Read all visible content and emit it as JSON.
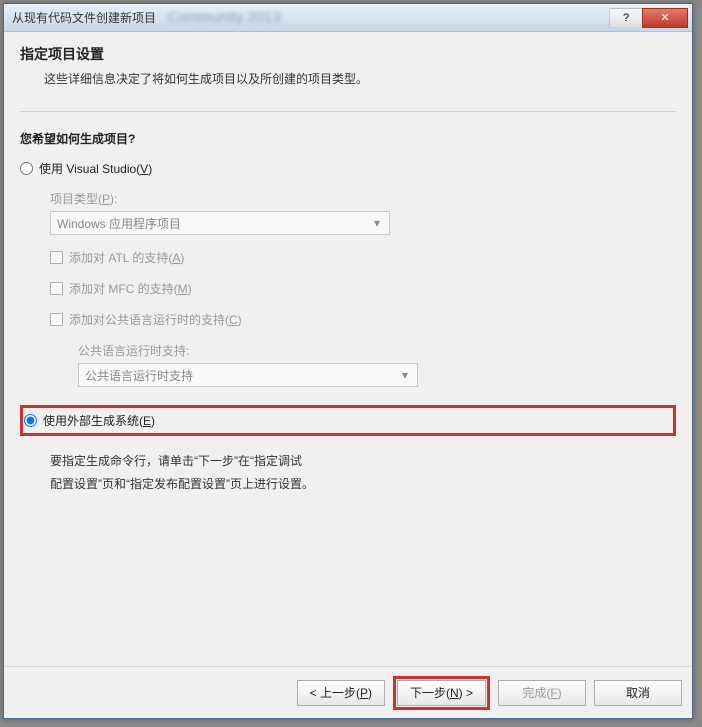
{
  "titlebar": {
    "title": "从现有代码文件创建新项目",
    "blur_text": "Community 2013",
    "help_icon": "?",
    "close_icon": "✕"
  },
  "header": {
    "title": "指定项目设置",
    "desc": "这些详细信息决定了将如何生成项目以及所创建的项目类型。"
  },
  "question": "您希望如何生成项目?",
  "option_vs": {
    "label_pre": "使用 Visual Studio(",
    "accel": "V",
    "label_post": ")",
    "project_type_label_pre": "项目类型(",
    "project_type_accel": "P",
    "project_type_label_post": "):",
    "project_type_value": "Windows 应用程序项目",
    "atl_pre": "添加对 ATL 的支持(",
    "atl_accel": "A",
    "atl_post": ")",
    "mfc_pre": "添加对 MFC 的支持(",
    "mfc_accel": "M",
    "mfc_post": ")",
    "clr_pre": "添加对公共语言运行时的支持(",
    "clr_accel": "C",
    "clr_post": ")",
    "clr_sub_label": "公共语言运行时支持:",
    "clr_sub_value": "公共语言运行时支持"
  },
  "option_ext": {
    "label_pre": "使用外部生成系统(",
    "accel": "E",
    "label_post": ")",
    "info_l1": "要指定生成命令行，请单击“下一步”在“指定调试",
    "info_l2": "配置设置”页和“指定发布配置设置”页上进行设置。"
  },
  "buttons": {
    "prev_pre": "< 上一步(",
    "prev_accel": "P",
    "prev_post": ")",
    "next_pre": "下一步(",
    "next_accel": "N",
    "next_post": ") >",
    "finish_pre": "完成(",
    "finish_accel": "F",
    "finish_post": ")",
    "cancel": "取消"
  }
}
